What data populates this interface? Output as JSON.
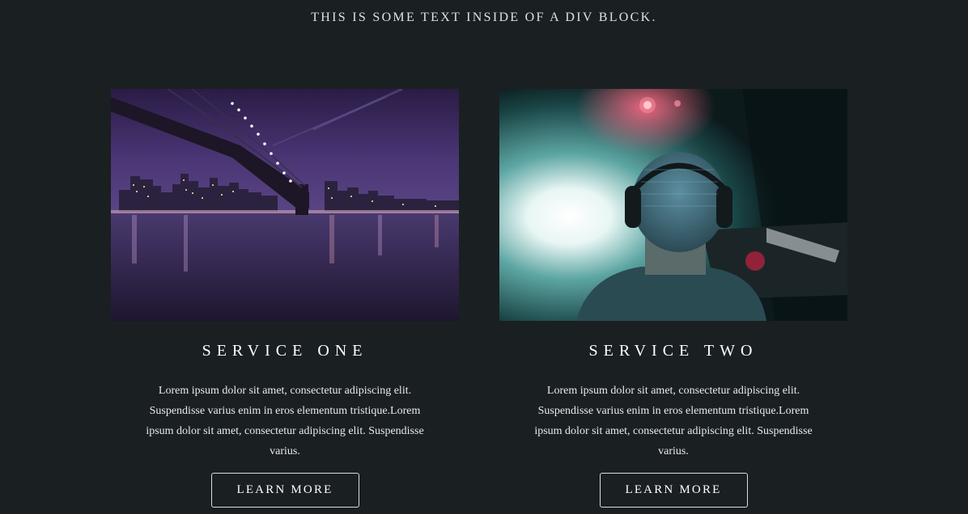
{
  "intro": {
    "text": "THIS IS SOME TEXT INSIDE OF A DIV BLOCK."
  },
  "services": [
    {
      "title": "SERVICE ONE",
      "image": "night-city-bridge-photo",
      "text": "Lorem ipsum dolor sit amet, consectetur adipiscing elit. Suspendisse varius enim in eros elementum tristique.Lorem ipsum dolor sit amet, consectetur adipiscing elit. Suspendisse varius.",
      "button_label": "LEARN MORE"
    },
    {
      "title": "SERVICE TWO",
      "image": "dj-headphones-photo",
      "text": "Lorem ipsum dolor sit amet, consectetur adipiscing elit. Suspendisse varius enim in eros elementum tristique.Lorem ipsum dolor sit amet, consectetur adipiscing elit. Suspendisse varius.",
      "button_label": "LEARN MORE"
    }
  ],
  "colors": {
    "background": "#1a1f22",
    "text": "#ffffff",
    "button_border": "#d9dcde"
  }
}
